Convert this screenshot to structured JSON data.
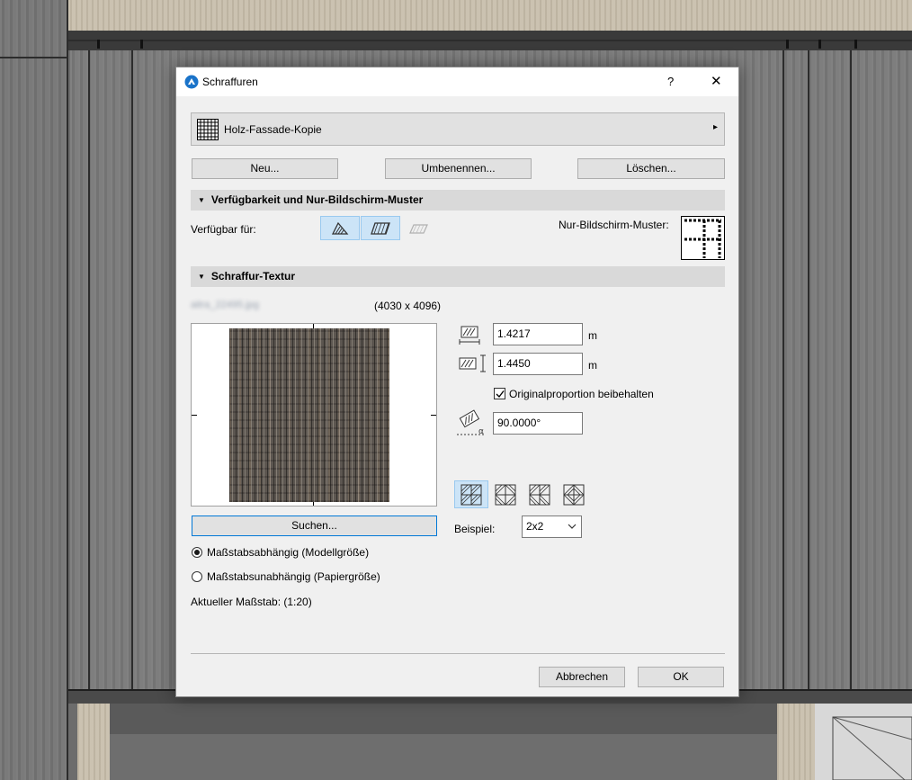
{
  "dialog": {
    "title": "Schraffuren",
    "help_label": "?",
    "close_label": "✕"
  },
  "pattern_selector": {
    "name": "Holz-Fassade-Kopie",
    "icon": "hatch-grid-icon",
    "arrow": "▸"
  },
  "actions": {
    "new_label": "Neu...",
    "rename_label": "Umbenennen...",
    "delete_label": "Löschen..."
  },
  "availability_section": {
    "title": "Verfügbarkeit und Nur-Bildschirm-Muster",
    "available_for_label": "Verfügbar für:",
    "screen_only_label": "Nur-Bildschirm-Muster:",
    "tool_icons": [
      "fill-tool-icon",
      "surface-tool-icon",
      "zone-tool-icon"
    ]
  },
  "texture_section": {
    "title": "Schraffur-Textur",
    "file_name": "aitra_22495.jpg",
    "image_size": "(4030 x 4096)",
    "width_value": "1.4217",
    "height_value": "1.4450",
    "unit": "m",
    "keep_proportion_label": "Originalproportion beibehalten",
    "keep_proportion_checked": true,
    "angle_value": "90.0000°",
    "search_label": "Suchen...",
    "example_label": "Beispiel:",
    "example_value": "2x2",
    "tiling_icons": [
      "tile-normal-icon",
      "tile-mirror-x-icon",
      "tile-mirror-y-icon",
      "tile-mirror-xy-icon"
    ]
  },
  "scale": {
    "model_label": "Maßstabsabhängig (Modellgröße)",
    "paper_label": "Maßstabsunabhängig (Papiergröße)",
    "selected": "model",
    "current_scale_label": "Aktueller Maßstab: (1:20)"
  },
  "footer": {
    "cancel_label": "Abbrechen",
    "ok_label": "OK"
  },
  "colors": {
    "accent": "#1a73c9",
    "selected_icon_bg": "#cce4f7",
    "section_bg": "#d9d9d9"
  }
}
